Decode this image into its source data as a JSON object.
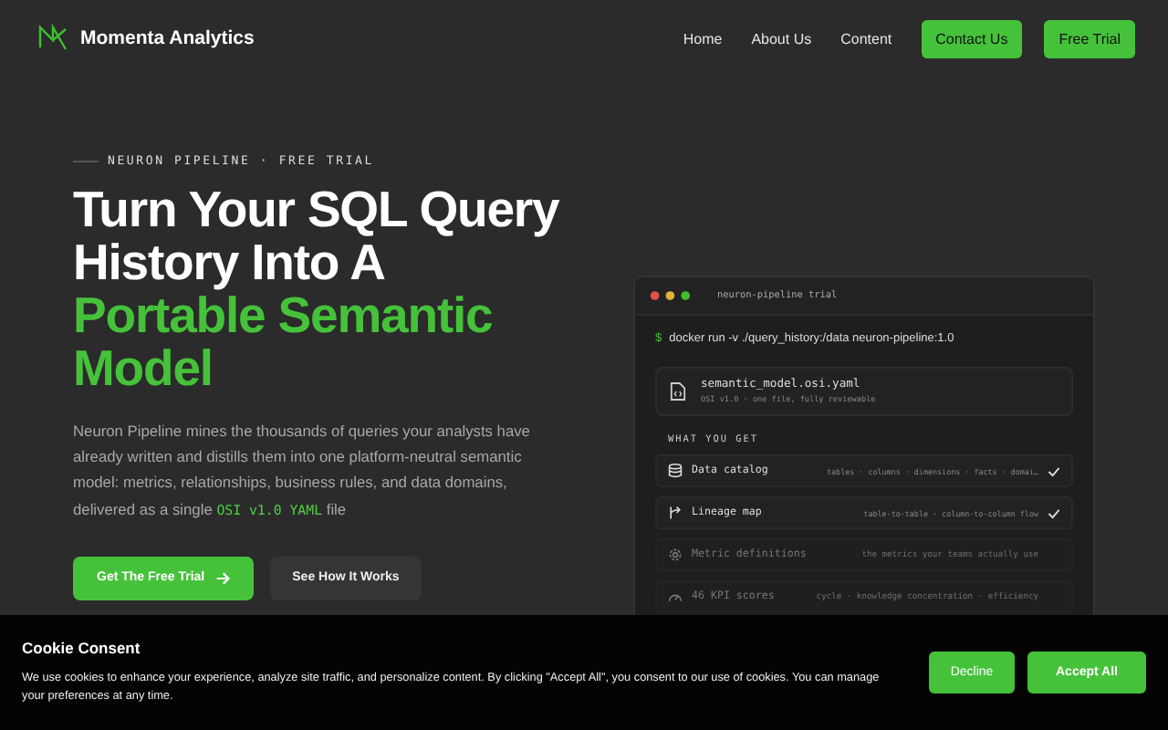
{
  "brand": {
    "name": "Momenta Analytics"
  },
  "nav": {
    "links": [
      "Home",
      "About Us",
      "Content"
    ],
    "buttons": [
      "Contact Us",
      "Free Trial"
    ]
  },
  "hero": {
    "eyebrow": "NEURON PIPELINE · FREE TRIAL",
    "title_lines": [
      "Turn Your SQL Query",
      "History Into A"
    ],
    "title_accent_lines": [
      "Portable Semantic",
      "Model"
    ],
    "description": "Neuron Pipeline mines the thousands of queries your analysts have already written and distills them into one platform-neutral semantic model: metrics, relationships, business rules, and data domains, delivered as a single",
    "description_code": "OSI v1.0 YAML",
    "description_end": "file",
    "primary_button": "Get The Free Trial",
    "secondary_button": "See How It Works"
  },
  "terminal": {
    "title": "neuron-pipeline trial",
    "prompt": "$",
    "command": "docker run -v ./query_history:/data neuron-pipeline:1.0",
    "file": {
      "name": "semantic_model.osi.yaml",
      "meta": "OSI v1.0 · one file, fully reviewable"
    },
    "section_label": "WHAT YOU GET",
    "features": [
      {
        "kind": "catalog",
        "name": "Data catalog",
        "detail": "tables · columns · dimensions · facts · domai…",
        "checked": true,
        "dimmed": false
      },
      {
        "kind": "lineage",
        "name": "Lineage map",
        "detail": "table-to-table · column-to-column flow",
        "checked": true,
        "dimmed": false
      },
      {
        "kind": "metric",
        "name": "Metric definitions",
        "detail": "the metrics your teams actually use",
        "checked": false,
        "dimmed": true
      },
      {
        "kind": "kpi",
        "name": "46 KPI scores",
        "detail": "cycle · knowledge concentration · efficiency",
        "checked": false,
        "dimmed": true
      }
    ]
  },
  "cookie": {
    "title": "Cookie Consent",
    "text": "We use cookies to enhance your experience, analyze site traffic, and personalize content. By clicking \"Accept All\", you consent to our use of cookies. You can manage your preferences at any time.",
    "buttons": [
      "Decline",
      "Accept All"
    ]
  }
}
